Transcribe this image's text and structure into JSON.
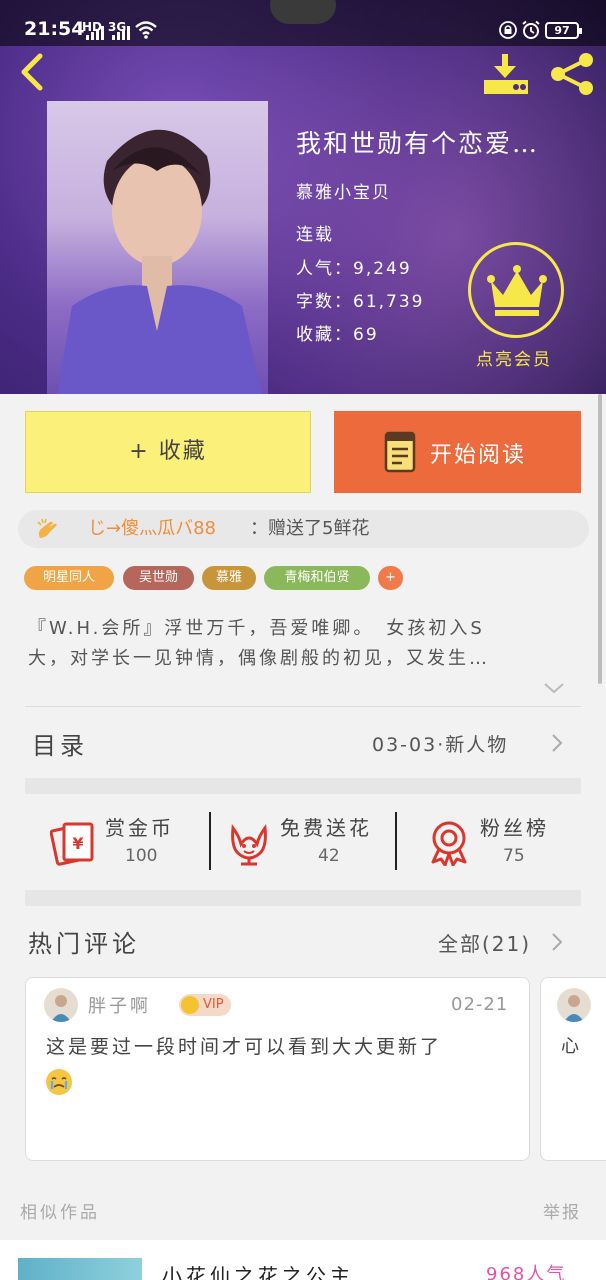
{
  "status_bar": {
    "time": "21:54",
    "signal1": "HD",
    "signal2": "3G",
    "battery": "97"
  },
  "book": {
    "title": "我和世勋有个恋爱…",
    "author": "慕雅小宝贝",
    "status": "连载",
    "popularity": "人气：9,249",
    "word_count": "字数：61,739",
    "favorites": "收藏：69"
  },
  "vip": {
    "label": "点亮会员"
  },
  "actions": {
    "collect": "+ 收藏",
    "read": "开始阅读"
  },
  "gift": {
    "user": "じ→傻灬瓜バ88",
    "text": "：赠送了5鲜花"
  },
  "tags": [
    {
      "label": "明星同人",
      "color": "#f0a445"
    },
    {
      "label": "吴世勋",
      "color": "#b6665a"
    },
    {
      "label": "慕雅",
      "color": "#c8963a"
    },
    {
      "label": "青梅和伯贤",
      "color": "#8bb85a"
    },
    {
      "label": "+",
      "color": "#f07a4a"
    }
  ],
  "synopsis": {
    "line1": "『W.H.会所』浮世万千，吾爱唯卿。　女孩初入S",
    "line2": "大，对学长一见钟情，偶像剧般的初见，又发生…"
  },
  "toc": {
    "label": "目录",
    "latest": "03-03·新人物"
  },
  "stats": [
    {
      "label": "赏金币",
      "value": "100",
      "icon": "red-envelope-icon"
    },
    {
      "label": "免费送花",
      "value": "42",
      "icon": "flower-icon"
    },
    {
      "label": "粉丝榜",
      "value": "75",
      "icon": "medal-icon"
    }
  ],
  "comments_section": {
    "title": "热门评论",
    "all": "全部(21)"
  },
  "comments": [
    {
      "user": "胖子啊",
      "badge": "VIP",
      "date": "02-21",
      "text": "这是要过一段时间才可以看到大大更新了"
    },
    {
      "text": "心"
    }
  ],
  "footer": {
    "similar": "相似作品",
    "report": "举报"
  },
  "similar": {
    "title": "小花仙之花之公主",
    "popularity": "968人气"
  },
  "colors": {
    "accent": "#ec6a3c",
    "collect": "#fbf07a",
    "vip": "#f7e84a",
    "popularity": "#e254a6"
  }
}
